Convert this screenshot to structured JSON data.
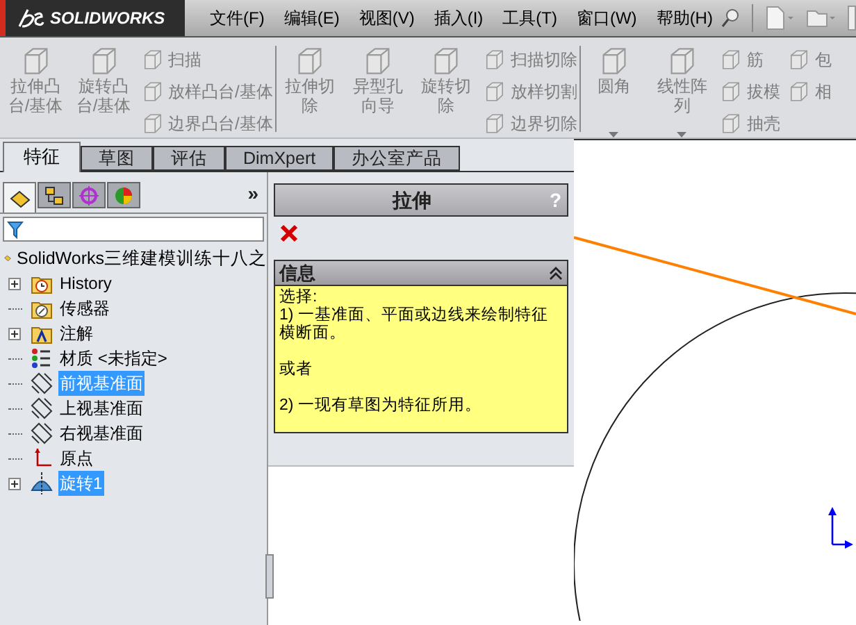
{
  "app": {
    "logo": "SOLIDWORKS"
  },
  "menu": [
    "文件(F)",
    "编辑(E)",
    "视图(V)",
    "插入(I)",
    "工具(T)",
    "窗口(W)",
    "帮助(H)"
  ],
  "toolbar": {
    "disabled": true,
    "groups": [
      {
        "columns": [
          {
            "kind": "large",
            "items": [
              {
                "label": "拉伸凸台/基体",
                "dropdown": false
              }
            ]
          },
          {
            "kind": "large",
            "items": [
              {
                "label": "旋转凸台/基体",
                "dropdown": false
              }
            ]
          },
          {
            "kind": "small",
            "items": [
              "扫描",
              "放样凸台/基体",
              "边界凸台/基体"
            ]
          }
        ]
      },
      {
        "columns": [
          {
            "kind": "large",
            "items": [
              {
                "label": "拉伸切除",
                "dropdown": false
              }
            ]
          },
          {
            "kind": "large",
            "items": [
              {
                "label": "异型孔向导",
                "dropdown": false
              }
            ]
          },
          {
            "kind": "large",
            "items": [
              {
                "label": "旋转切除",
                "dropdown": false
              }
            ]
          },
          {
            "kind": "small",
            "items": [
              "扫描切除",
              "放样切割",
              "边界切除"
            ]
          }
        ]
      },
      {
        "columns": [
          {
            "kind": "large",
            "items": [
              {
                "label": "圆角",
                "dropdown": true
              }
            ]
          },
          {
            "kind": "large",
            "items": [
              {
                "label": "线性阵列",
                "dropdown": true
              }
            ]
          },
          {
            "kind": "small",
            "items": [
              "筋",
              "拔模",
              "抽壳"
            ]
          },
          {
            "kind": "small",
            "items": [
              "包",
              "相"
            ]
          }
        ]
      }
    ]
  },
  "command_tabs": [
    {
      "label": "特征",
      "selected": true
    },
    {
      "label": "草图",
      "selected": false
    },
    {
      "label": "评估",
      "selected": false
    },
    {
      "label": "DimXpert",
      "selected": false
    },
    {
      "label": "办公室产品",
      "selected": false
    }
  ],
  "tree_panel": {
    "tabs": [
      {
        "kind": "feature",
        "selected": true
      },
      {
        "kind": "property",
        "selected": false
      },
      {
        "kind": "config",
        "selected": false
      },
      {
        "kind": "display",
        "selected": false
      }
    ],
    "more": "»",
    "root": {
      "label": "SolidWorks三维建模训练十八之",
      "children": [
        {
          "label": "History",
          "kind": "history",
          "expandable": true,
          "selected": false
        },
        {
          "label": "传感器",
          "kind": "sensor",
          "expandable": false,
          "selected": false
        },
        {
          "label": "注解",
          "kind": "annotation",
          "expandable": true,
          "selected": false
        },
        {
          "label": "材质 <未指定>",
          "kind": "material",
          "expandable": false,
          "selected": false
        },
        {
          "label": "前视基准面",
          "kind": "plane",
          "expandable": false,
          "selected": true
        },
        {
          "label": "上视基准面",
          "kind": "plane",
          "expandable": false,
          "selected": false
        },
        {
          "label": "右视基准面",
          "kind": "plane",
          "expandable": false,
          "selected": false
        },
        {
          "label": "原点",
          "kind": "origin",
          "expandable": false,
          "selected": false
        },
        {
          "label": "旋转1",
          "kind": "revolve",
          "expandable": true,
          "selected": true
        }
      ]
    }
  },
  "property_manager": {
    "title": "拉伸",
    "help": "?",
    "info": {
      "title": "信息",
      "paragraphs": [
        [
          "选择:",
          "1) 一基准面、平面或边线来绘制特征横断面。"
        ],
        [
          "或者"
        ],
        [
          "2) 一现有草图为特征所用。"
        ]
      ]
    }
  }
}
